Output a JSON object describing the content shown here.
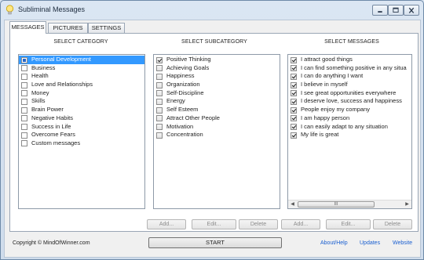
{
  "window": {
    "title": "Subliminal Messages"
  },
  "tabs": [
    {
      "label": "MESSAGES",
      "active": true
    },
    {
      "label": "PICTURES",
      "active": false
    },
    {
      "label": "SETTINGS",
      "active": false
    }
  ],
  "columns": {
    "category_header": "SELECT CATEGORY",
    "subcategory_header": "SELECT SUBCATEGORY",
    "messages_header": "SELECT MESSAGES"
  },
  "categories": [
    {
      "label": "Personal Development",
      "checked": true,
      "selected": true
    },
    {
      "label": "Business",
      "checked": false
    },
    {
      "label": "Health",
      "checked": false
    },
    {
      "label": "Love and Relationships",
      "checked": false
    },
    {
      "label": "Money",
      "checked": false
    },
    {
      "label": "Skills",
      "checked": false
    },
    {
      "label": "Brain Power",
      "checked": false
    },
    {
      "label": "Negative Habits",
      "checked": false
    },
    {
      "label": "Success in Life",
      "checked": false
    },
    {
      "label": "Overcome Fears",
      "checked": false
    },
    {
      "label": "Custom messages",
      "checked": false
    }
  ],
  "subcategories": [
    {
      "label": "Positive Thinking",
      "checked": true
    },
    {
      "label": "Achieving Goals",
      "checked": false
    },
    {
      "label": "Happiness",
      "checked": false
    },
    {
      "label": "Organization",
      "checked": false
    },
    {
      "label": "Self-Discipline",
      "checked": false
    },
    {
      "label": "Energy",
      "checked": false
    },
    {
      "label": "Self Esteem",
      "checked": false
    },
    {
      "label": "Attract Other People",
      "checked": false
    },
    {
      "label": "Motivation",
      "checked": false
    },
    {
      "label": "Concentration",
      "checked": false
    }
  ],
  "messages": [
    {
      "label": "I attract good things",
      "checked": true
    },
    {
      "label": "I can find something positive in any situa",
      "checked": true
    },
    {
      "label": "I can do anything I want",
      "checked": true
    },
    {
      "label": "I believe in myself",
      "checked": true
    },
    {
      "label": "I see great opportunities everywhere",
      "checked": true
    },
    {
      "label": "I deserve love, success and happiness",
      "checked": true
    },
    {
      "label": "People enjoy my company",
      "checked": true
    },
    {
      "label": "I am happy person",
      "checked": true
    },
    {
      "label": "I can easily adapt to any situation",
      "checked": true
    },
    {
      "label": "My life is great",
      "checked": true
    }
  ],
  "subcategory_buttons": {
    "add": "Add...",
    "edit": "Edit...",
    "delete": "Delete"
  },
  "message_buttons": {
    "add": "Add...",
    "edit": "Edit...",
    "delete": "Delete"
  },
  "scroll_thumb_grip": "III",
  "footer": {
    "copyright": "Copyright © MindOfWinner.com",
    "start": "START",
    "links": [
      "About/Help",
      "Updates",
      "Website"
    ]
  },
  "icons": {
    "app": "lightbulb-icon",
    "minimize": "minimize-icon",
    "maximize": "maximize-icon",
    "close": "close-icon",
    "scroll_left": "arrow-left-icon",
    "scroll_right": "arrow-right-icon"
  },
  "colors": {
    "link": "#1a5fd0",
    "selection": "#3399ff",
    "check_square": "#2a68c8"
  }
}
